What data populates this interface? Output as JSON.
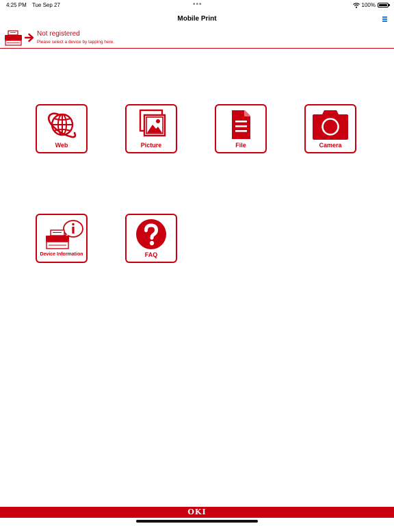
{
  "status_bar": {
    "time": "4:25 PM",
    "date": "Tue Sep 27",
    "battery_text": "100%",
    "battery_level": 1.0
  },
  "nav": {
    "title": "Mobile Print",
    "menu_icon": "menu-icon"
  },
  "device_banner": {
    "title": "Not registered",
    "subtitle": "Please select a device by tapping here."
  },
  "tiles": {
    "web": {
      "label": "Web"
    },
    "picture": {
      "label": "Picture"
    },
    "file": {
      "label": "File"
    },
    "camera": {
      "label": "Camera"
    },
    "device_info": {
      "label": "Device Information"
    },
    "faq": {
      "label": "FAQ"
    }
  },
  "footer": {
    "logo_text": "OKI"
  },
  "colors": {
    "brand_red": "#c90010",
    "menu_blue": "#1e7cf2"
  }
}
